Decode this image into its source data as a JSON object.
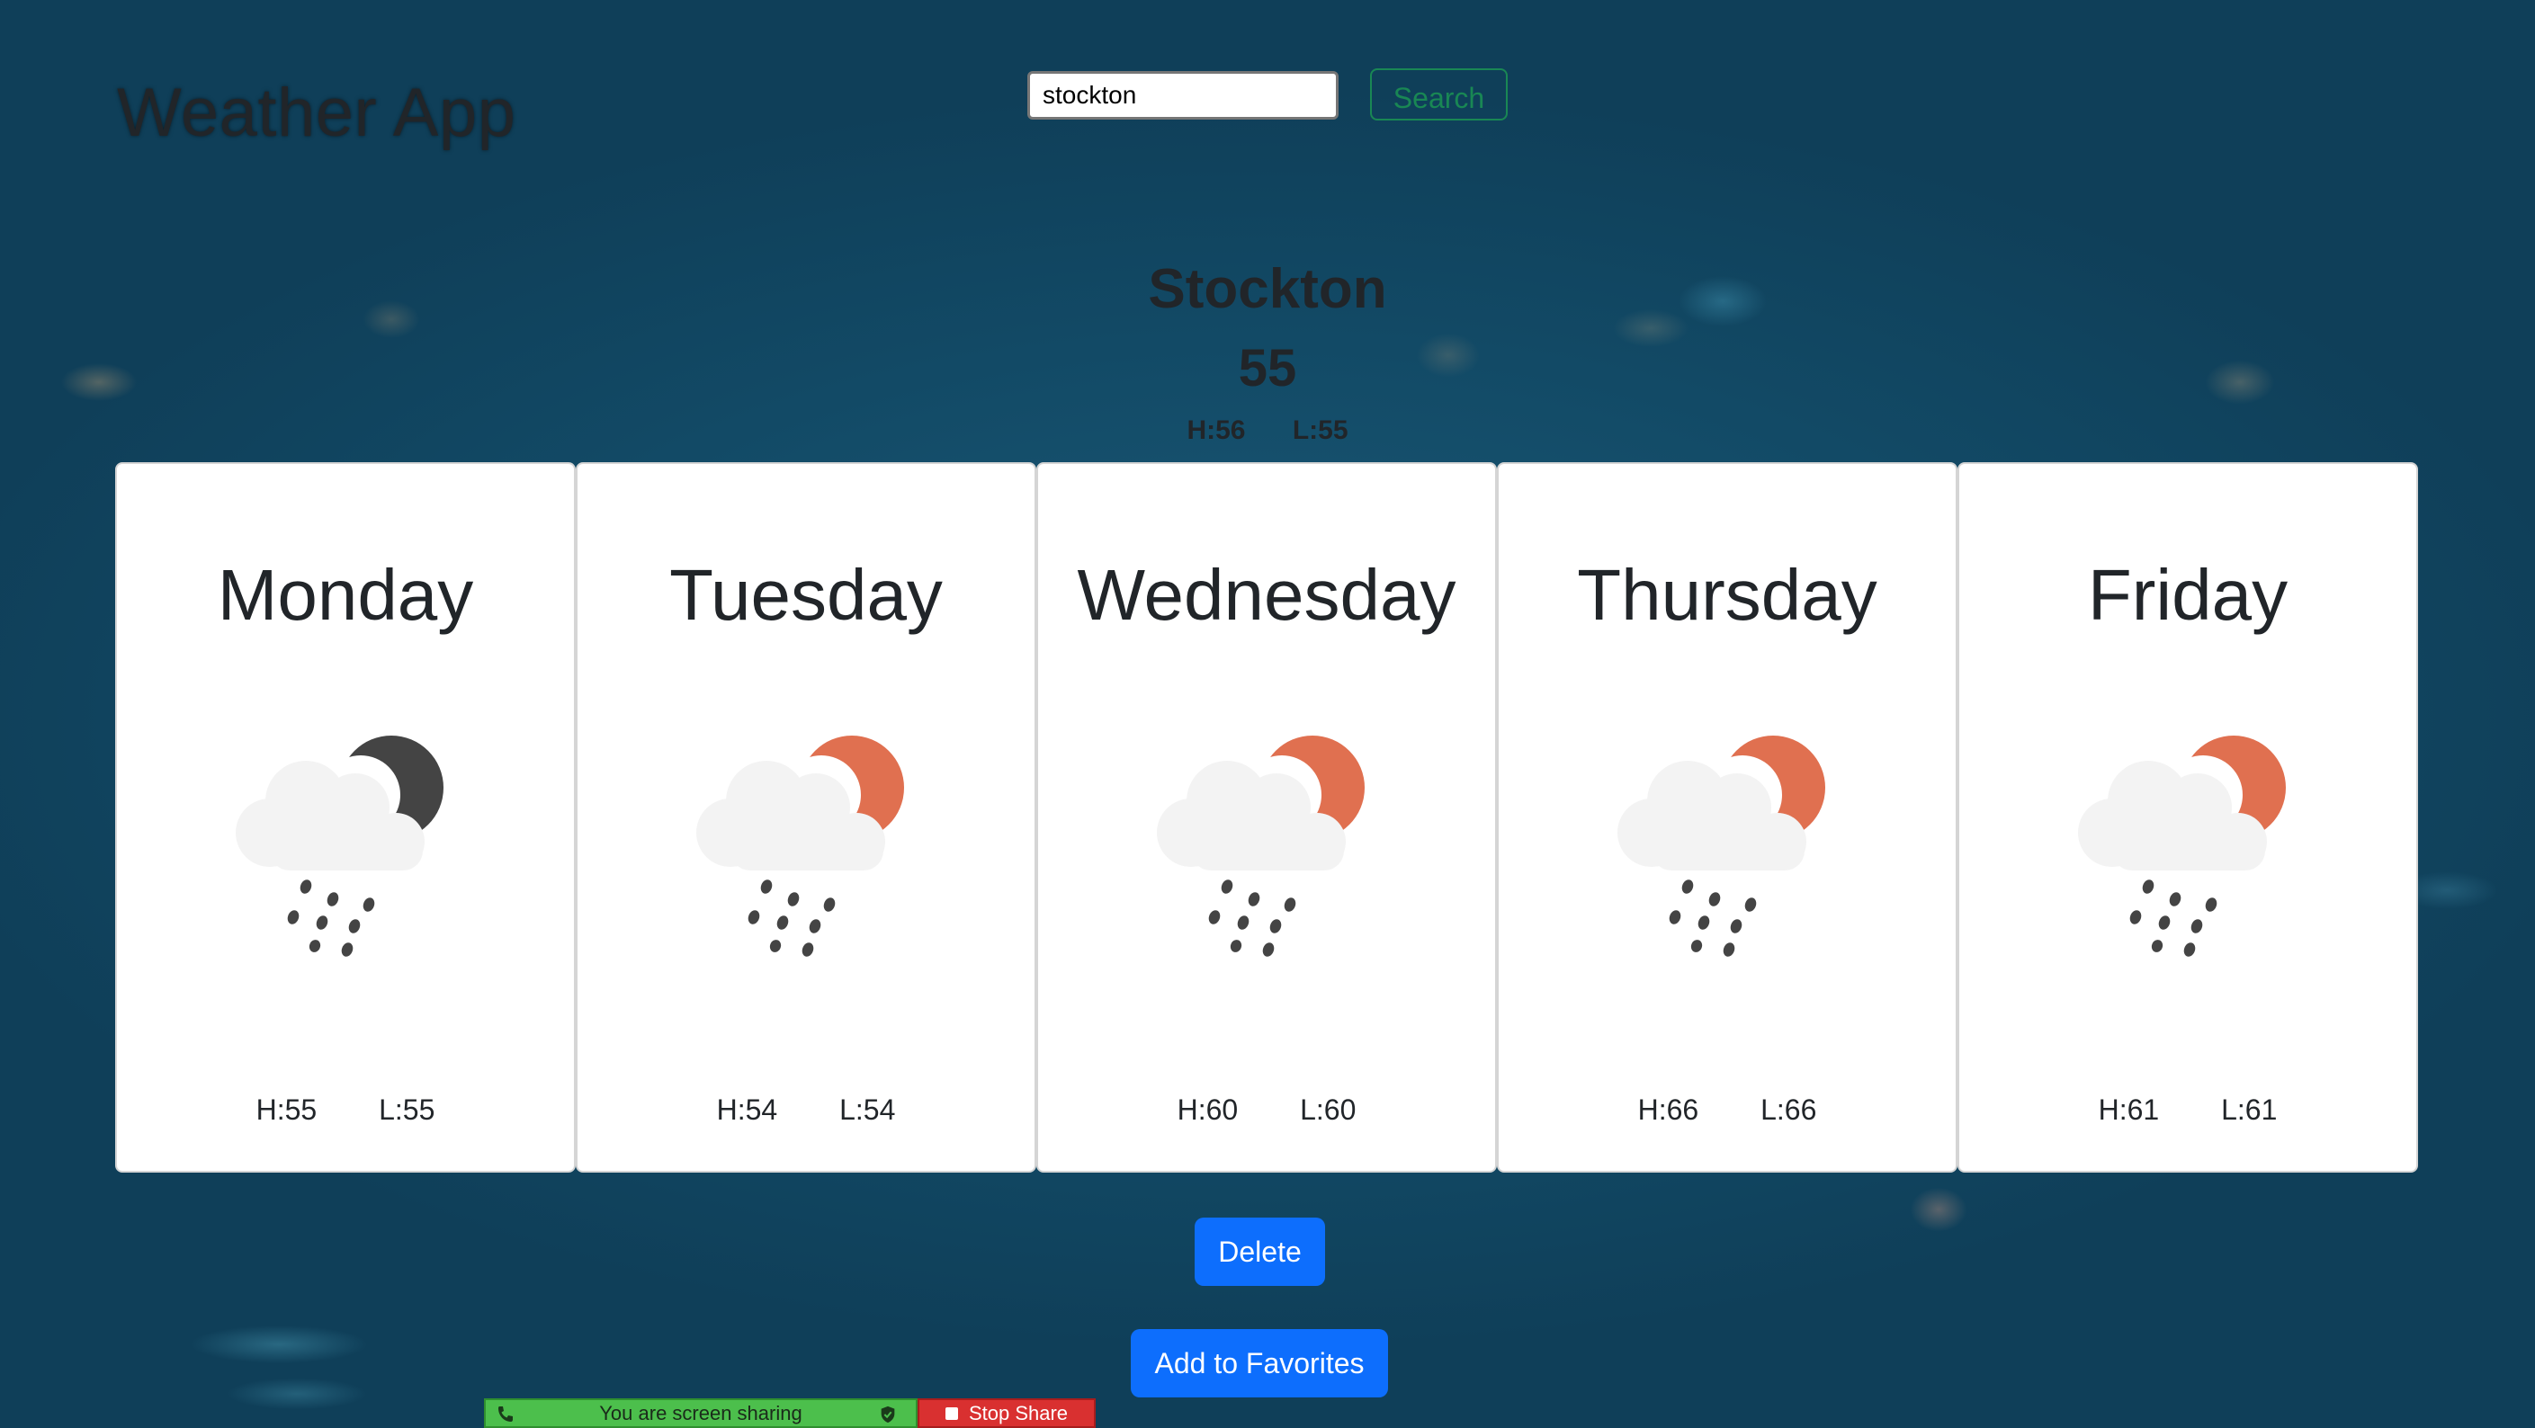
{
  "app": {
    "title": "Weather App"
  },
  "search": {
    "value": "stockton",
    "button_label": "Search"
  },
  "current": {
    "city": "Stockton",
    "temp": "55",
    "high": "H:56",
    "low": "L:55"
  },
  "forecast": [
    {
      "day": "Monday",
      "icon": "rain-night-icon",
      "high": "H:55",
      "low": "L:55"
    },
    {
      "day": "Tuesday",
      "icon": "rain-day-icon",
      "high": "H:54",
      "low": "L:54"
    },
    {
      "day": "Wednesday",
      "icon": "rain-day-icon",
      "high": "H:60",
      "low": "L:60"
    },
    {
      "day": "Thursday",
      "icon": "rain-day-icon",
      "high": "H:66",
      "low": "L:66"
    },
    {
      "day": "Friday",
      "icon": "rain-day-icon",
      "high": "H:61",
      "low": "L:61"
    }
  ],
  "actions": {
    "delete_label": "Delete",
    "favorites_label": "Add to Favorites"
  },
  "share_bar": {
    "status": "You are screen sharing",
    "stop_label": "Stop Share"
  },
  "colors": {
    "primary": "#0d6efd",
    "success": "#198754",
    "sun": "#e07050",
    "moon": "#444444",
    "share_green": "#4cbf4c",
    "share_red": "#d93030"
  }
}
